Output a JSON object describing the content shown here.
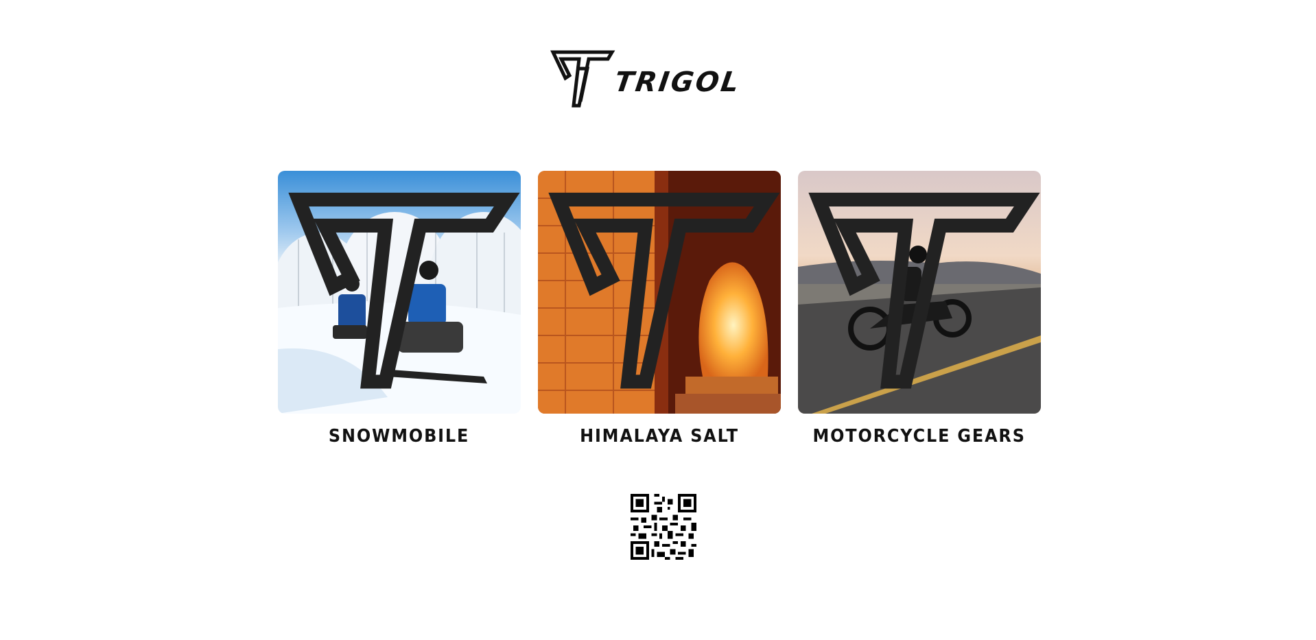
{
  "brand": {
    "name": "TRIGOL",
    "logo_icon": "trigol-triangle-logo"
  },
  "cards": [
    {
      "label": "SNOWMOBILE",
      "image": "snowmobile-riders-in-snow-photo"
    },
    {
      "label": "HIMALAYA SALT",
      "image": "himalayan-salt-lamp-photo"
    },
    {
      "label": "MOTORCYCLE GEARS",
      "image": "motorcycle-rider-on-highway-photo"
    }
  ],
  "qr": {
    "icon": "qr-code"
  },
  "colors": {
    "text": "#111111",
    "background": "#ffffff"
  }
}
